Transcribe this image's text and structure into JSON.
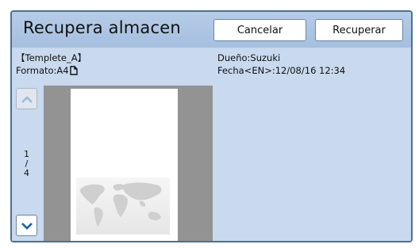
{
  "dialog": {
    "title": "Recupera almacen",
    "buttons": {
      "cancel": "Cancelar",
      "recover": "Recuperar"
    }
  },
  "job": {
    "name": "【Templete_A】",
    "format_label": "Formato:A4",
    "owner": "Dueño:Suzuki",
    "date": "Fecha<EN>:12/08/16 12:34"
  },
  "pager": {
    "current": "1",
    "separator": "/",
    "total": "4"
  },
  "icons": {
    "page_orientation": "portrait-page-icon",
    "up": "chevron-up-icon",
    "down": "chevron-down-icon",
    "preview_image": "world-map-image"
  },
  "colors": {
    "accent": "#1d5fa8",
    "header": "#b0c7e5",
    "body": "#c9d9ee",
    "preview_bg": "#939393"
  }
}
